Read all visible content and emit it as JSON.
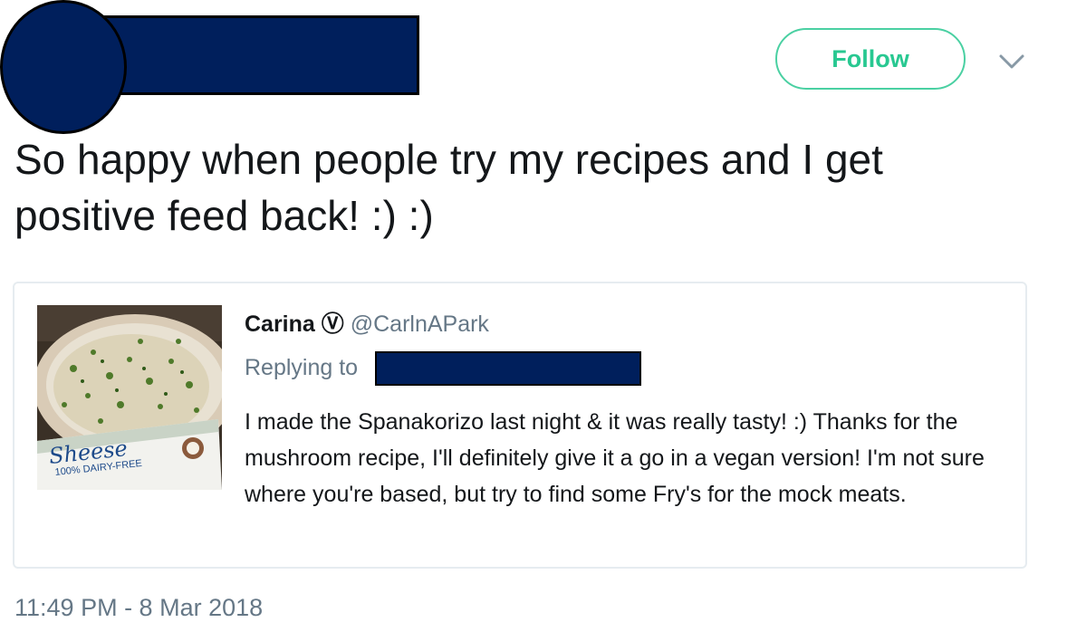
{
  "header": {
    "follow_label": "Follow"
  },
  "tweet": {
    "text": "So happy when people try my recipes and I get positive feed back! :) :)",
    "timestamp": "11:49 PM - 8 Mar 2018"
  },
  "quoted_tweet": {
    "author_name": "Carina",
    "author_symbol": "Ⓥ",
    "author_handle": "@CarlnAPark",
    "replying_label": "Replying to",
    "text": "I made the Spanakorizo last night & it was really tasty! :) Thanks for the mushroom recipe, I'll definitely give it a go in a vegan version! I'm not sure where you're based, but try to find some Fry's for the mock meats.",
    "image": {
      "package_brand": "Sheese",
      "package_tagline": "100% DAIRY-FREE"
    }
  },
  "colors": {
    "accent_green": "#28c891",
    "redaction": "#001f5c",
    "muted_text": "#657786",
    "border": "#e6ecf0"
  }
}
